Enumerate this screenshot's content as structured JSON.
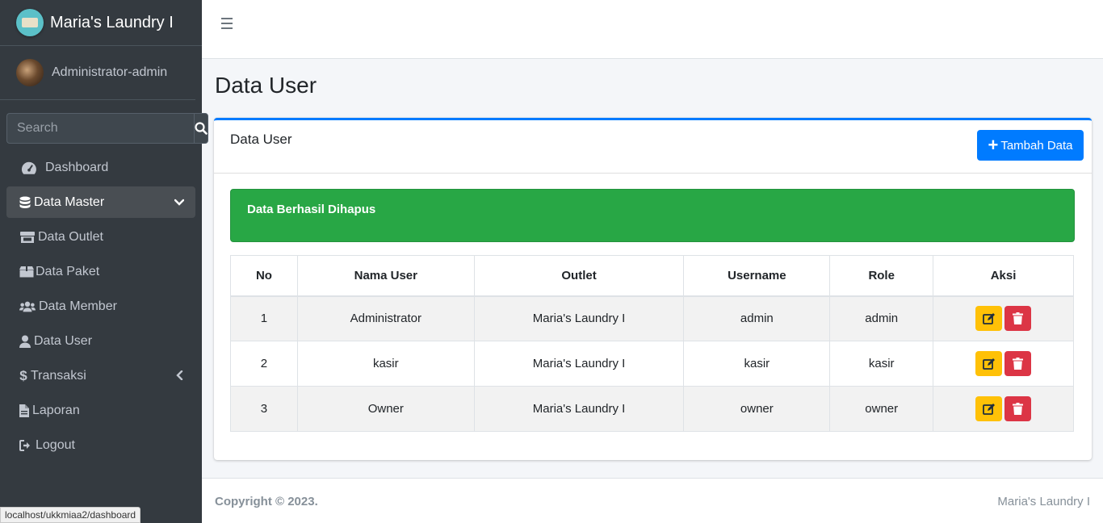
{
  "brand": {
    "name": "Maria's Laundry I"
  },
  "user": {
    "name": "Administrator-admin"
  },
  "search": {
    "placeholder": "Search"
  },
  "nav": {
    "dashboard": "Dashboard",
    "data_master": "Data Master",
    "data_outlet": "Data Outlet",
    "data_paket": "Data Paket",
    "data_member": "Data Member",
    "data_user": "Data User",
    "transaksi": "Transaksi",
    "laporan": "Laporan",
    "logout": "Logout"
  },
  "page": {
    "title": "Data User"
  },
  "card": {
    "title": "Data User",
    "add_button": "Tambah Data",
    "alert": "Data Berhasil Dihapus"
  },
  "table": {
    "headers": [
      "No",
      "Nama User",
      "Outlet",
      "Username",
      "Role",
      "Aksi"
    ],
    "rows": [
      [
        "1",
        "Administrator",
        "Maria's Laundry I",
        "admin",
        "admin"
      ],
      [
        "2",
        "kasir",
        "Maria's Laundry I",
        "kasir",
        "kasir"
      ],
      [
        "3",
        "Owner",
        "Maria's Laundry I",
        "owner",
        "owner"
      ]
    ]
  },
  "footer": {
    "copyright": "Copyright © 2023.",
    "right": "Maria's Laundry I"
  },
  "status_bar": {
    "url": "localhost/ukkmiaa2/dashboard"
  },
  "colors": {
    "primary": "#007bff",
    "success": "#28a745",
    "warning": "#ffc107",
    "danger": "#dc3545",
    "sidebar": "#343a40"
  }
}
